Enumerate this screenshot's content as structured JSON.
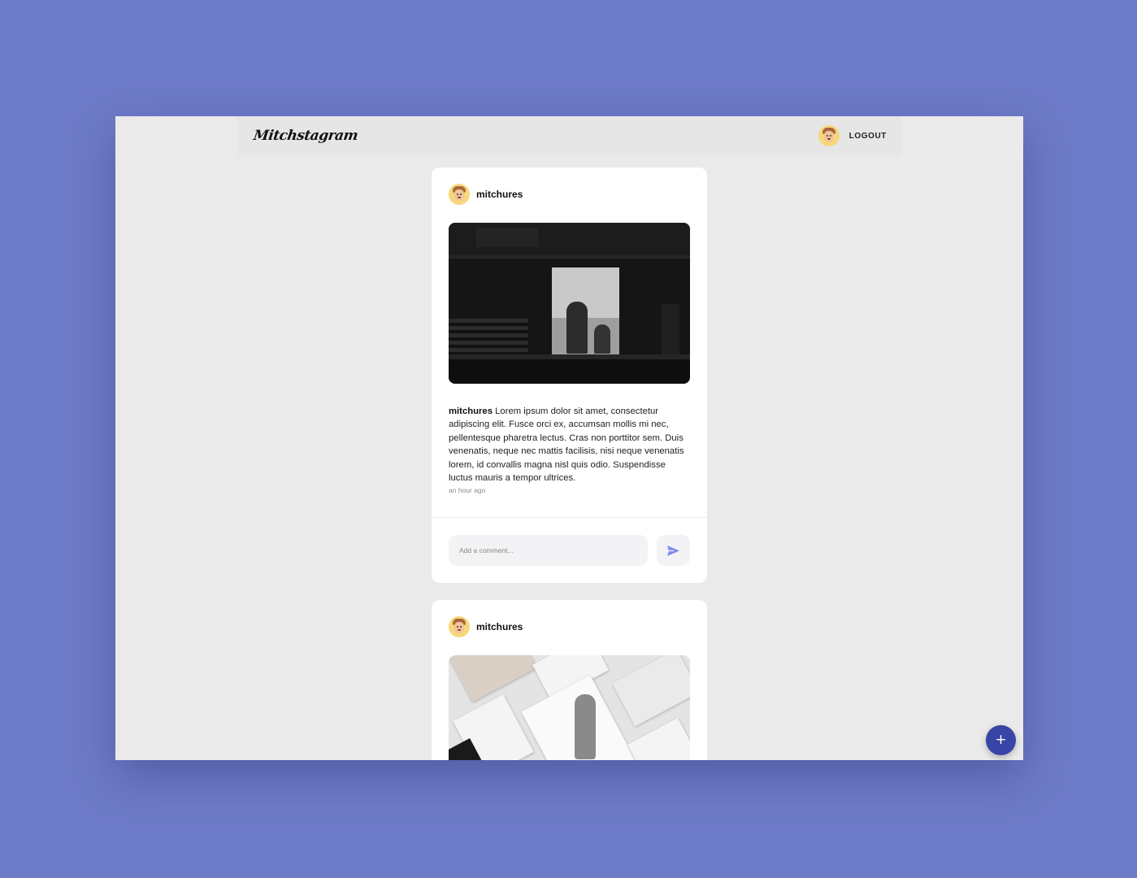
{
  "app": {
    "logo_text": "Mitchstagram"
  },
  "navbar": {
    "logout_label": "LOGOUT",
    "avatar_icon": "user-avatar-icon"
  },
  "posts": [
    {
      "username": "mitchures",
      "caption_user": "mitchures",
      "caption": "Lorem ipsum dolor sit amet, consectetur adipiscing elit. Fusce orci ex, accumsan mollis mi nec, pellentesque pharetra lectus. Cras non porttitor sem. Duis venenatis, neque nec mattis facilisis, nisi neque venenatis lorem, id convallis magna nisl quis odio. Suspendisse luctus mauris a tempor ultrices.",
      "timestamp": "an hour ago",
      "comment_placeholder": "Add a comment..."
    },
    {
      "username": "mitchures"
    }
  ],
  "fab": {
    "label": "+"
  },
  "colors": {
    "background": "#6e7bc8",
    "accent": "#3844a6",
    "send_icon": "#7b8cf0"
  }
}
